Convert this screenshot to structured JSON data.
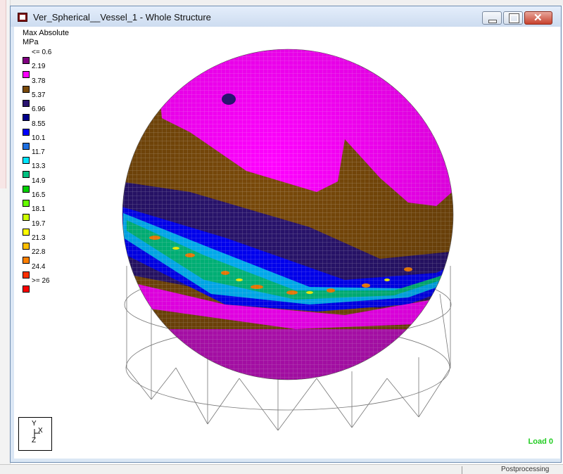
{
  "window": {
    "title": "Ver_Spherical__Vessel_1 - Whole Structure",
    "buttons": [
      "minimize",
      "maximize",
      "close"
    ]
  },
  "legend": {
    "title": "Max Absolute",
    "unit": "MPa",
    "items": [
      {
        "label": "<= 0.6",
        "color": "#800080"
      },
      {
        "label": "2.19",
        "color": "#ff00ff"
      },
      {
        "label": "3.78",
        "color": "#7a4a0a"
      },
      {
        "label": "5.37",
        "color": "#2a1470"
      },
      {
        "label": "6.96",
        "color": "#00008b"
      },
      {
        "label": "8.55",
        "color": "#0000ff"
      },
      {
        "label": "10.1",
        "color": "#1e6fe0"
      },
      {
        "label": "11.7",
        "color": "#00e5ff"
      },
      {
        "label": "13.3",
        "color": "#00c080"
      },
      {
        "label": "14.9",
        "color": "#00d000"
      },
      {
        "label": "16.5",
        "color": "#66ff00"
      },
      {
        "label": "18.1",
        "color": "#ccff00"
      },
      {
        "label": "19.7",
        "color": "#ffff00"
      },
      {
        "label": "21.3",
        "color": "#ffbf00"
      },
      {
        "label": "22.8",
        "color": "#ff8000"
      },
      {
        "label": "24.4",
        "color": "#ff3000"
      },
      {
        "label": ">= 26",
        "color": "#ff0000"
      }
    ]
  },
  "axis_triad": {
    "y": "Y",
    "x": "X",
    "z": "Z"
  },
  "load_case": "Load 0",
  "statusbar": {
    "text": "Postprocessing"
  }
}
